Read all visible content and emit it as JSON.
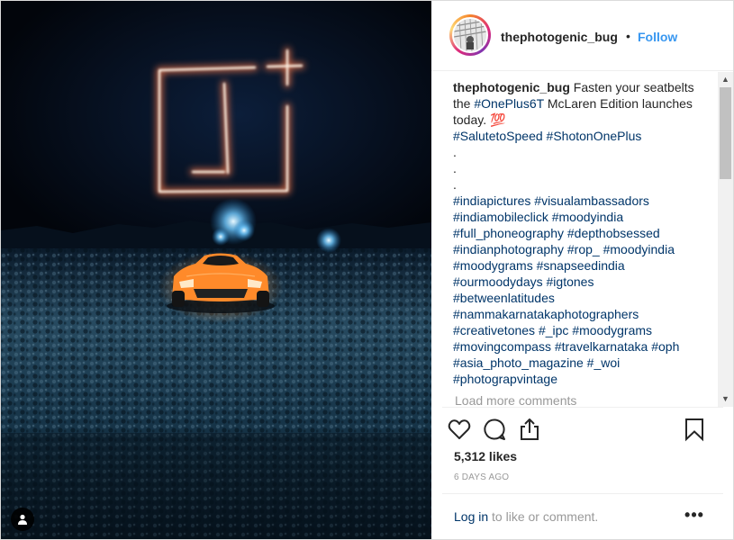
{
  "post": {
    "username": "thephotogenic_bug",
    "separator": "•",
    "follow_label": "Follow",
    "caption_user": "thephotogenic_bug",
    "caption_lines": [
      {
        "parts": [
          {
            "t": "Fasten your seatbelts",
            "tag": false
          }
        ]
      },
      {
        "parts": [
          {
            "t": "the ",
            "tag": false
          },
          {
            "t": "#OnePlus6T",
            "tag": true
          },
          {
            "t": " McLaren Edition launches",
            "tag": false
          }
        ]
      },
      {
        "parts": [
          {
            "t": "today. 💯",
            "tag": false
          }
        ]
      },
      {
        "parts": [
          {
            "t": "#SalutetoSpeed",
            "tag": true
          },
          {
            "t": " ",
            "tag": false
          },
          {
            "t": "#ShotonOnePlus",
            "tag": true
          }
        ]
      },
      {
        "parts": [
          {
            "t": ".",
            "tag": false
          }
        ]
      },
      {
        "parts": [
          {
            "t": ".",
            "tag": false
          }
        ]
      },
      {
        "parts": [
          {
            "t": ".",
            "tag": false
          }
        ]
      },
      {
        "parts": [
          {
            "t": "#indiapictures",
            "tag": true
          },
          {
            "t": " ",
            "tag": false
          },
          {
            "t": "#visualambassadors",
            "tag": true
          }
        ]
      },
      {
        "parts": [
          {
            "t": "#indiamobileclick",
            "tag": true
          },
          {
            "t": " ",
            "tag": false
          },
          {
            "t": "#moodyindia",
            "tag": true
          }
        ]
      },
      {
        "parts": [
          {
            "t": "#full_phoneography",
            "tag": true
          },
          {
            "t": " ",
            "tag": false
          },
          {
            "t": "#depthobsessed",
            "tag": true
          }
        ]
      },
      {
        "parts": [
          {
            "t": "#indianphotography",
            "tag": true
          },
          {
            "t": " ",
            "tag": false
          },
          {
            "t": "#rop_",
            "tag": true
          },
          {
            "t": " ",
            "tag": false
          },
          {
            "t": "#moodyindia",
            "tag": true
          }
        ]
      },
      {
        "parts": [
          {
            "t": "#moodygrams",
            "tag": true
          },
          {
            "t": " ",
            "tag": false
          },
          {
            "t": "#snapseedindia",
            "tag": true
          }
        ]
      },
      {
        "parts": [
          {
            "t": "#ourmoodydays",
            "tag": true
          },
          {
            "t": " ",
            "tag": false
          },
          {
            "t": "#igtones",
            "tag": true
          }
        ]
      },
      {
        "parts": [
          {
            "t": "#betweenlatitudes",
            "tag": true
          }
        ]
      },
      {
        "parts": [
          {
            "t": "#nammakarnatakaphotographers",
            "tag": true
          }
        ]
      },
      {
        "parts": [
          {
            "t": "#creativetones",
            "tag": true
          },
          {
            "t": " ",
            "tag": false
          },
          {
            "t": "#_ipc",
            "tag": true
          },
          {
            "t": " ",
            "tag": false
          },
          {
            "t": "#moodygrams",
            "tag": true
          }
        ]
      },
      {
        "parts": [
          {
            "t": "#movingcompass",
            "tag": true
          },
          {
            "t": " ",
            "tag": false
          },
          {
            "t": "#travelkarnataka",
            "tag": true
          },
          {
            "t": " ",
            "tag": false
          },
          {
            "t": "#oph",
            "tag": true
          }
        ]
      },
      {
        "parts": [
          {
            "t": "#asia_photo_magazine",
            "tag": true
          },
          {
            "t": " ",
            "tag": false
          },
          {
            "t": "#_woi",
            "tag": true
          }
        ]
      },
      {
        "parts": [
          {
            "t": "#photograpvintage",
            "tag": true
          }
        ]
      }
    ],
    "load_more": "Load more comments",
    "likes": "5,312 likes",
    "time": "6 DAYS AGO"
  },
  "footer": {
    "login_link": "Log in",
    "login_rest": " to like or comment.",
    "more_label": "•••"
  },
  "icons": {
    "like": "heart-icon",
    "comment": "comment-icon",
    "share": "share-icon",
    "save": "bookmark-icon",
    "user_tag": "user-tag-icon",
    "more": "more-options-icon"
  },
  "colors": {
    "link": "#3897f0",
    "hashtag": "#003569",
    "muted": "#999999",
    "text": "#262626",
    "car": "#ff8a2a"
  }
}
